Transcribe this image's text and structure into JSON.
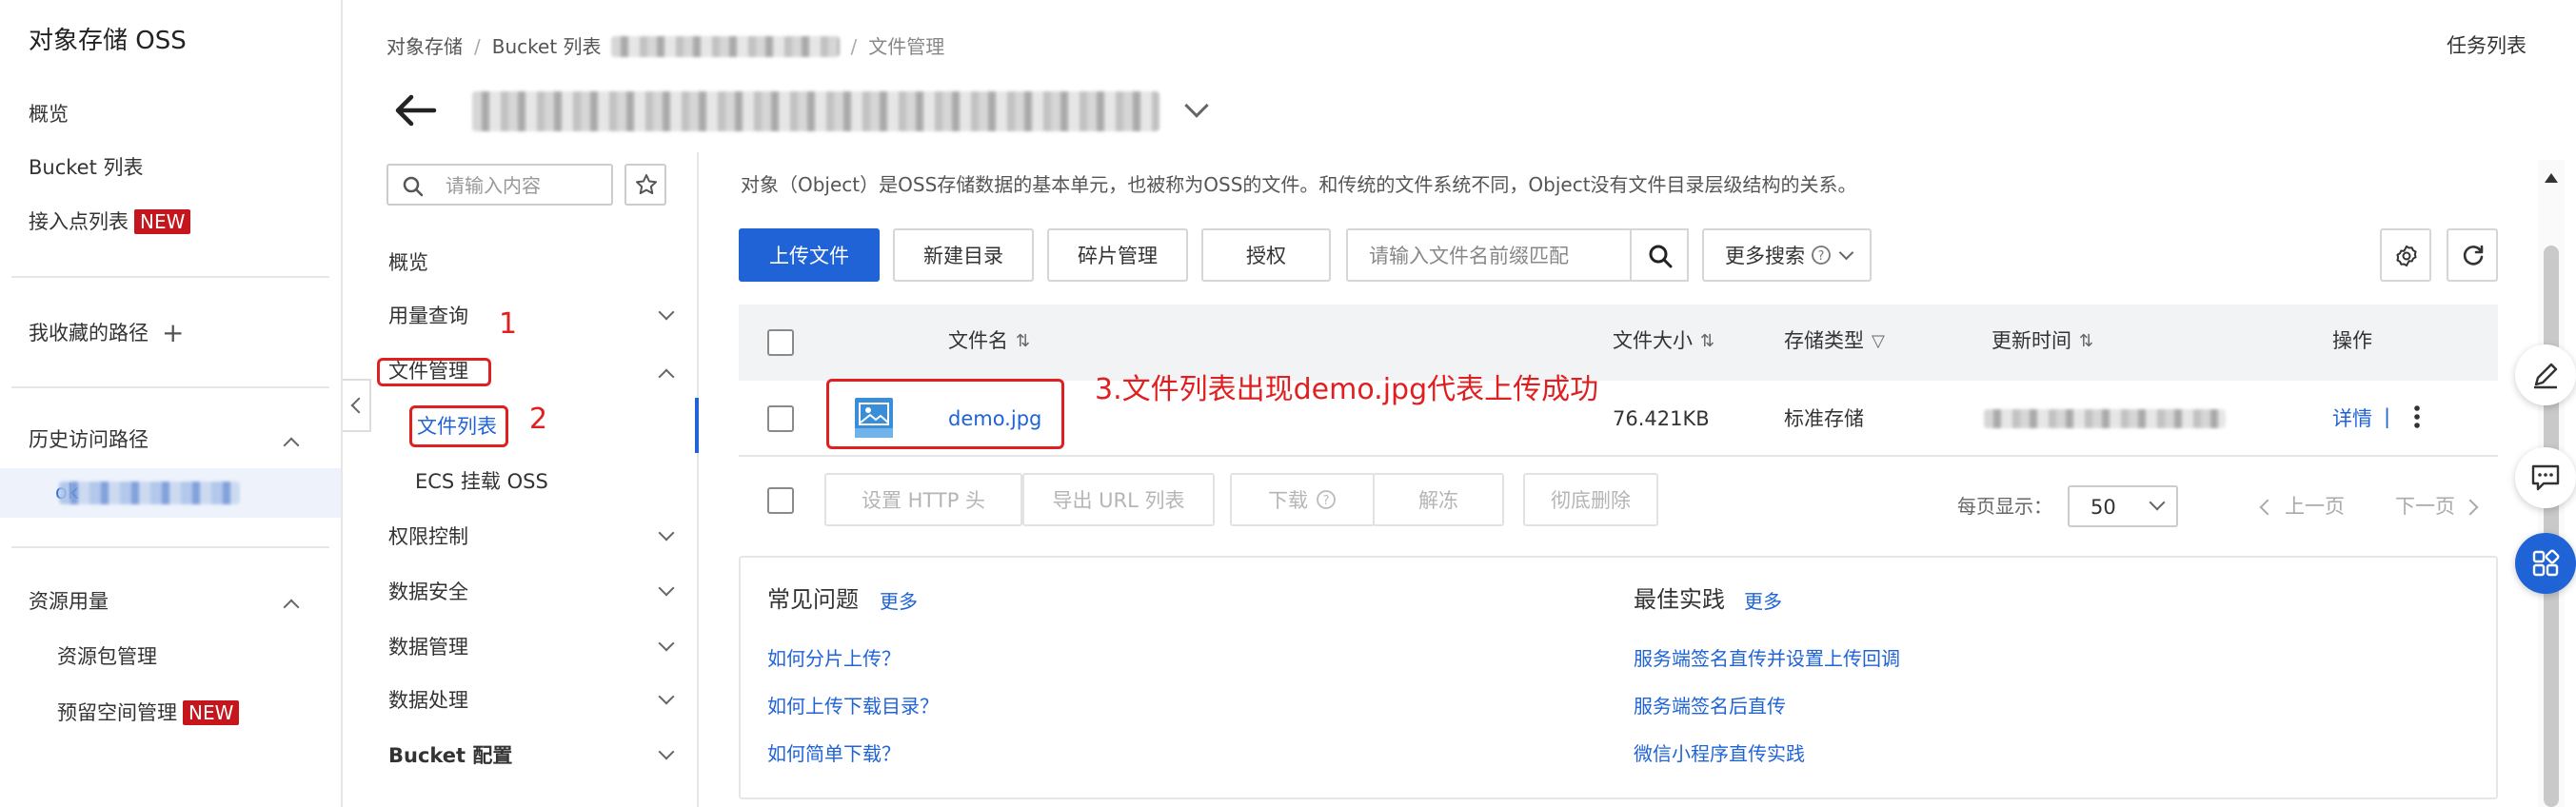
{
  "sidebar": {
    "title": "对象存储 OSS",
    "items": [
      "概览",
      "Bucket 列表",
      "接入点列表"
    ],
    "new_badge": "NEW",
    "favorites_label": "我收藏的路径",
    "history_label": "历史访问路径",
    "history_item": "ok",
    "resources_label": "资源用量",
    "resources_items": [
      "资源包管理",
      "预留空间管理"
    ]
  },
  "breadcrumb": [
    "对象存储",
    "Bucket 列表",
    "文件管理"
  ],
  "task_list": "任务列表",
  "inner_nav": {
    "search_placeholder": "请输入内容",
    "items": [
      "概览",
      "用量查询",
      "文件管理",
      "文件列表",
      "ECS 挂载 OSS",
      "权限控制",
      "数据安全",
      "数据管理",
      "数据处理",
      "Bucket 配置"
    ]
  },
  "annotations": {
    "step1": "1",
    "step2": "2",
    "step3": "3.文件列表出现demo.jpg代表上传成功"
  },
  "main": {
    "intro": "对象（Object）是OSS存储数据的基本单元，也被称为OSS的文件。和传统的文件系统不同，Object没有文件目录层级结构的关系。",
    "toolbar": {
      "upload": "上传文件",
      "new_dir": "新建目录",
      "fragments": "碎片管理",
      "authorize": "授权",
      "search_placeholder": "请输入文件名前缀匹配",
      "more_search": "更多搜索"
    },
    "table": {
      "headers": [
        "文件名",
        "文件大小",
        "存储类型",
        "更新时间",
        "操作"
      ],
      "rows": [
        {
          "name": "demo.jpg",
          "size": "76.421KB",
          "storage": "标准存储",
          "action_detail": "详情",
          "action_sep": "|"
        }
      ]
    },
    "bottom_actions": [
      "设置 HTTP 头",
      "导出 URL 列表",
      "下载",
      "解冻",
      "彻底删除"
    ],
    "page_size_label": "每页显示：",
    "page_size": "50",
    "prev_page": "上一页",
    "next_page": "下一页",
    "faq": {
      "title": "常见问题",
      "more": "更多",
      "items": [
        "如何分片上传？",
        "如何上传下载目录？",
        "如何简单下载？"
      ]
    },
    "best_practice": {
      "title": "最佳实践",
      "more": "更多",
      "items": [
        "服务端签名直传并设置上传回调",
        "服务端签名后直传",
        "微信小程序直传实践"
      ]
    }
  },
  "colors": {
    "primary": "#1f63d6",
    "annotation": "#e02020",
    "badge": "#c4161c"
  }
}
